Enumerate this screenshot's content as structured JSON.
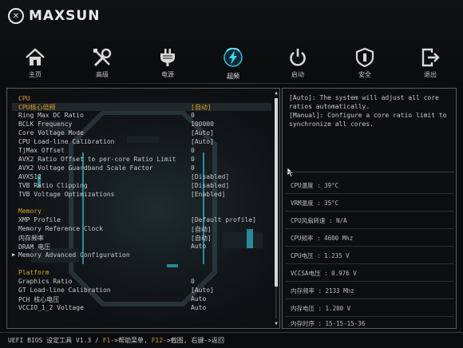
{
  "brand": {
    "name": "MAXSUN"
  },
  "nav": [
    {
      "label": "主页",
      "icon": "home-icon"
    },
    {
      "label": "高级",
      "icon": "tools-icon"
    },
    {
      "label": "电源",
      "icon": "power-plug-icon"
    },
    {
      "label": "超频",
      "icon": "overclock-bolt-icon",
      "active": true
    },
    {
      "label": "启动",
      "icon": "power-button-icon"
    },
    {
      "label": "安全",
      "icon": "security-shield-icon"
    },
    {
      "label": "退出",
      "icon": "exit-icon"
    }
  ],
  "sections": [
    {
      "title": "CPU",
      "rows": [
        {
          "label": "CPU核心倍频",
          "value": "[自动]",
          "selected": true
        },
        {
          "label": "Ring Max DC Ratio",
          "value": "0"
        },
        {
          "label": "BCLK Frequency",
          "value": "100000"
        },
        {
          "label": "Core Voltage Mode",
          "value": "[Auto]"
        },
        {
          "label": "CPU Load-line Calibration",
          "value": "[Auto]"
        },
        {
          "label": "TjMax Offset",
          "value": "0"
        },
        {
          "label": "AVX2 Ratio Offset to per-core Ratio Limit",
          "value": "0"
        },
        {
          "label": "AVX2 Voltage Guardband Scale Factor",
          "value": "0"
        },
        {
          "label": "AVX512",
          "value": "[Disabled]"
        },
        {
          "label": "TVB Ratio Clipping",
          "value": "[Disabled]"
        },
        {
          "label": "TVB Voltage Optimizations",
          "value": "[Enabled]"
        }
      ]
    },
    {
      "title": "Memory",
      "rows": [
        {
          "label": "XMP Profile",
          "value": "[Default profile]"
        },
        {
          "label": "Memory Reference Clock",
          "value": "[自动]"
        },
        {
          "label": "内存频率",
          "value": "[自动]"
        },
        {
          "label": "DRAM 电压",
          "value": "Auto"
        },
        {
          "label": "Memory Advanced Configuration",
          "value": "",
          "submenu": true
        }
      ]
    },
    {
      "title": "Platform",
      "rows": [
        {
          "label": "Graphics Ratio",
          "value": "0"
        },
        {
          "label": "GT Load-line Calibration",
          "value": "[Auto]"
        },
        {
          "label": "PCH 核心电压",
          "value": "Auto"
        },
        {
          "label": "VCCIO_1_2 Voltage",
          "value": "Auto"
        }
      ]
    }
  ],
  "help": {
    "text": "[Auto]: The system will adjust all core ratios automatically.\n[Manual]: Configure a core ratio limit to synchronize all cores."
  },
  "status": [
    {
      "text": "CPU温度 : 39°C"
    },
    {
      "text": "VRM温度 : 35°C"
    },
    {
      "text": "CPU风扇转速 : N/A"
    },
    {
      "text": "CPU频率 : 4600 Mhz"
    },
    {
      "text": "CPU电压 : 1.235 V"
    },
    {
      "text": "VCCSA电压 : 0.976 V"
    },
    {
      "text": "内存频率 : 2133 Mhz"
    },
    {
      "text": "内存电压 : 1.200 V"
    },
    {
      "text": "内存时序 : 15-15-15-36"
    }
  ],
  "footer": {
    "prefix": "UEFI BIOS 设定工具 V1.3 / ",
    "f1_key": "F1",
    "f1_text": "->帮助菜单, ",
    "f12_key": "F12",
    "f12_text": "->截图, 右键->返回"
  },
  "colors": {
    "accent": "#e0a020",
    "background": "#0b0c0e",
    "border": "#5a5d60"
  }
}
